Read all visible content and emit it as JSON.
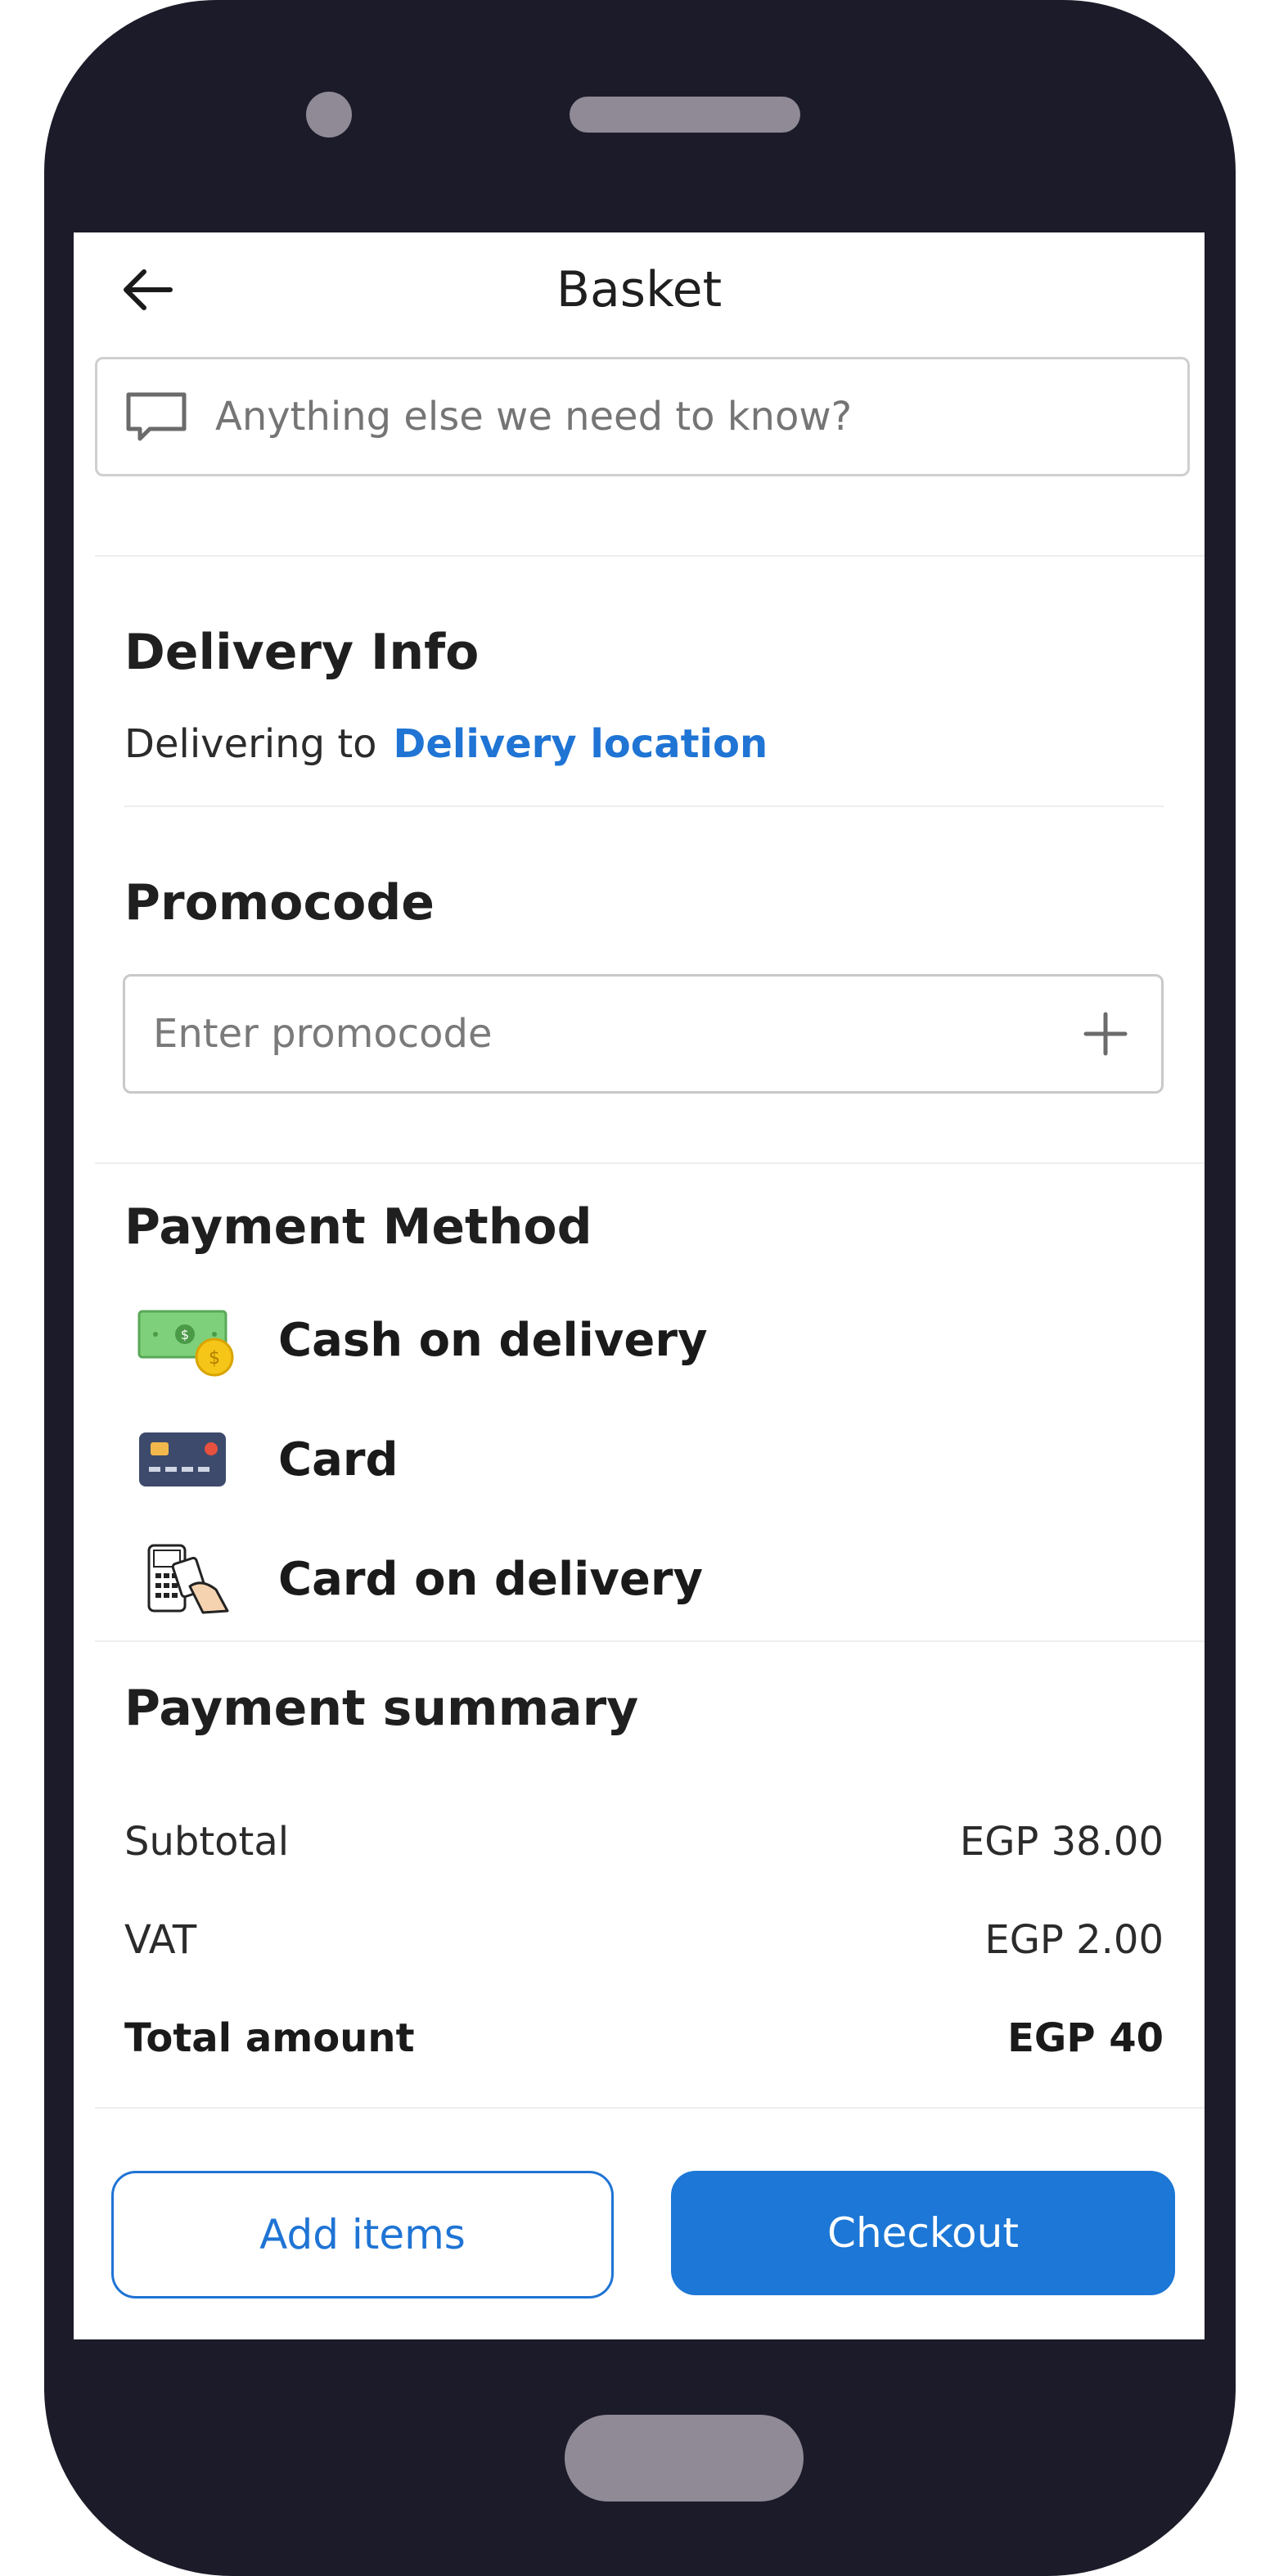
{
  "header": {
    "title": "Basket",
    "back_icon": "arrow-left-icon"
  },
  "notes": {
    "placeholder": "Anything else we need to know?",
    "icon": "chat-bubble-icon"
  },
  "delivery": {
    "heading": "Delivery Info",
    "prefix": "Delivering to",
    "location_link": "Delivery location"
  },
  "promocode": {
    "heading": "Promocode",
    "placeholder": "Enter promocode",
    "add_icon": "plus-icon"
  },
  "payment": {
    "heading": "Payment Method",
    "methods": [
      {
        "label": "Cash on delivery",
        "icon": "cash-icon"
      },
      {
        "label": "Card",
        "icon": "credit-card-icon"
      },
      {
        "label": "Card on delivery",
        "icon": "pos-terminal-icon"
      }
    ]
  },
  "summary": {
    "heading": "Payment summary",
    "rows": [
      {
        "label": "Subtotal",
        "value": "EGP 38.00"
      },
      {
        "label": "VAT",
        "value": "EGP 2.00"
      },
      {
        "label": "Total amount",
        "value": "EGP 40"
      }
    ]
  },
  "actions": {
    "add_items": "Add items",
    "checkout": "Checkout"
  },
  "colors": {
    "accent": "#1f74d4",
    "frame": "#1c1b29"
  }
}
